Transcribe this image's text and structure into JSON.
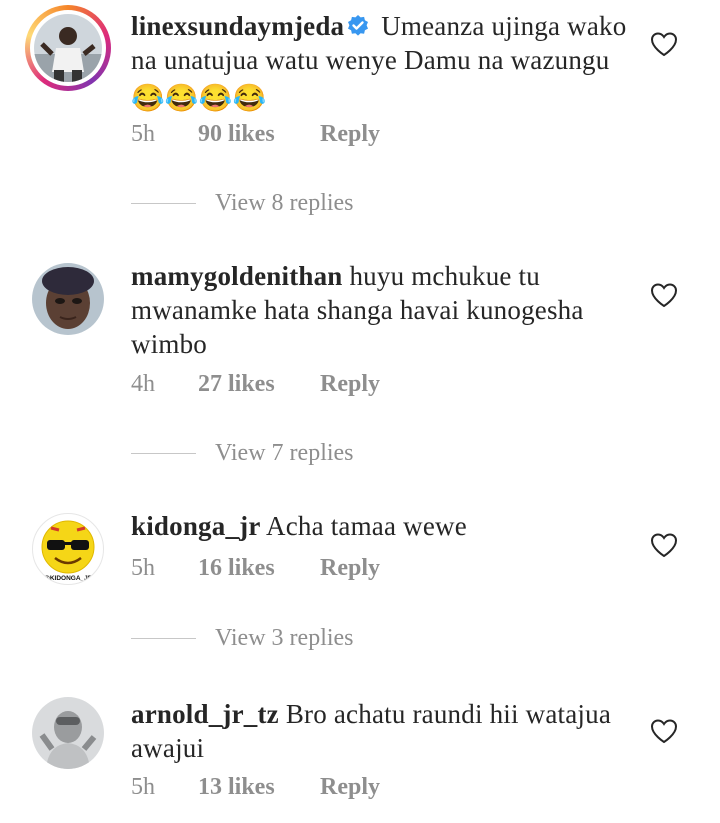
{
  "comments": [
    {
      "username": "linexsundaymjeda",
      "verified": true,
      "text": "Umeanza ujinga wako na unatujua watu wenye Damu na wazungu",
      "emoji": "😂😂😂😂",
      "time": "5h",
      "likes": "90 likes",
      "reply": "Reply",
      "view_replies": "View 8 replies"
    },
    {
      "username": "mamygoldenithan",
      "text": "huyu mchukue tu mwanamke hata shanga havai kunogesha wimbo",
      "time": "4h",
      "likes": "27 likes",
      "reply": "Reply",
      "view_replies": "View 7 replies"
    },
    {
      "username": "kidonga_jr",
      "avatar_text": "@KIDONGA_JR",
      "text": "Acha tamaa wewe",
      "time": "5h",
      "likes": "16 likes",
      "reply": "Reply",
      "view_replies": "View 3 replies"
    },
    {
      "username": "arnold_jr_tz",
      "text": "Bro achatu raundi hii watajua awajui",
      "time": "5h",
      "likes": "13 likes",
      "reply": "Reply"
    }
  ],
  "colors": {
    "text": "#262626",
    "muted": "#8e8e8e",
    "verified": "#3897f0"
  },
  "icons": {
    "like": "heart-outline-icon",
    "verified": "verified-badge-icon"
  }
}
